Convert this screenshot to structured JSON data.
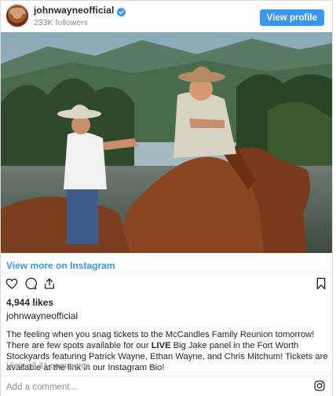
{
  "header": {
    "username": "johnwayneofficial",
    "followers": "233K followers",
    "view_profile_label": "View profile"
  },
  "photo": {
    "description_icon": "post-photo"
  },
  "view_more_label": "View more on Instagram",
  "actions": {
    "icons": [
      "heart-icon",
      "comment-icon",
      "share-icon",
      "bookmark-icon"
    ]
  },
  "likes": "4,944 likes",
  "caption": {
    "username": "johnwayneofficial",
    "text_before": "The feeling when you snag tickets to the McCandles Family Reunion tomorrow! There are few spots available for our ",
    "bold": "LIVE",
    "text_after": " Big Jake panel in the Fort Worth Stockyards featuring Patrick Wayne, Ethan Wayne, and Chris Mitchum! Tickets are available at the link in our Instagram Bio!"
  },
  "comments_link": "View all 31 comments",
  "comment_placeholder": "Add a comment...",
  "colors": {
    "accent": "#3897f0",
    "text": "#262626",
    "muted": "#8e8e8e"
  }
}
